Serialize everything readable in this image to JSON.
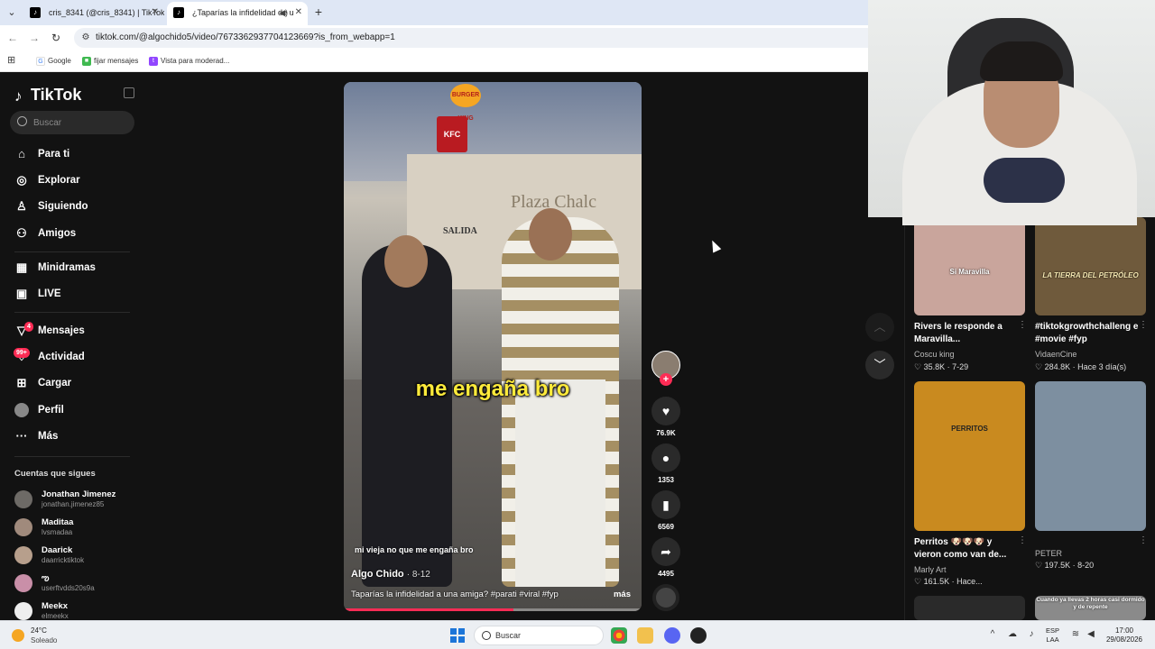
{
  "browser": {
    "tabs": [
      {
        "title": "cris_8341 (@cris_8341) | TikTok",
        "active": false
      },
      {
        "title": "¿Taparías la infidelidad de u",
        "active": true
      }
    ],
    "url": "tiktok.com/@algochido5/video/7673362937704123669?is_from_webapp=1",
    "bookmarks": [
      {
        "label": "Google"
      },
      {
        "label": "fijar mensajes"
      },
      {
        "label": "Vista para moderad..."
      }
    ]
  },
  "sidebar": {
    "logo": "TikTok",
    "search_placeholder": "Buscar",
    "nav": [
      {
        "label": "Para ti",
        "icon": "home-icon"
      },
      {
        "label": "Explorar",
        "icon": "compass-icon"
      },
      {
        "label": "Siguiendo",
        "icon": "following-icon"
      },
      {
        "label": "Amigos",
        "icon": "friends-icon"
      },
      {
        "label": "Minidramas",
        "icon": "film-icon"
      },
      {
        "label": "LIVE",
        "icon": "live-icon"
      },
      {
        "label": "Mensajes",
        "icon": "messages-icon",
        "badge": "4"
      },
      {
        "label": "Actividad",
        "icon": "activity-icon",
        "badge": "99+"
      },
      {
        "label": "Cargar",
        "icon": "upload-icon"
      },
      {
        "label": "Perfil",
        "icon": "profile-avatar"
      },
      {
        "label": "Más",
        "icon": "more-icon"
      }
    ],
    "following_title": "Cuentas que sigues",
    "following": [
      {
        "name": "Jonathan Jimenez",
        "handle": "jonathan.jimenez85"
      },
      {
        "name": "Maditaa",
        "handle": "lvsmadaa"
      },
      {
        "name": "Daarick",
        "handle": "daarricktiktok"
      },
      {
        "name": "ఌ",
        "handle": "userftvdds20s9a"
      },
      {
        "name": "Meekx",
        "handle": "elmeekx"
      }
    ]
  },
  "video": {
    "overlay_caption": "me engaña bro",
    "subtitle": "mi vieja no que me engaña bro",
    "author": "Algo Chido",
    "date": "· 8-12",
    "description": "Taparías la infidelidad a una amiga? #parati #viral #fyp",
    "more_label": "más",
    "scene_sign": "Plaza Chalc",
    "scene_salida": "SALIDA",
    "scene_kfc": "KFC",
    "scene_bk": "BURGER KING",
    "progress": 0.57
  },
  "actions": {
    "likes": "76.9K",
    "comments": "1353",
    "saves": "6569",
    "shares": "4495"
  },
  "recommendations": [
    {
      "thumb_text": "Si Maravilla",
      "title": "Rivers le responde a Maravilla...",
      "author": "Coscu king",
      "stats": "♡ 35.8K · 7-29",
      "color": "#c9a59c"
    },
    {
      "thumb_text": "LA TIERRA DEL PETRÓLEO",
      "title": "#tiktokgrowthchalleng e #movie #fyp",
      "author": "VidaenCine",
      "stats": "♡ 284.8K · Hace 3 día(s)",
      "color": "#6f5a3c"
    },
    {
      "thumb_text": "PERRITOS",
      "title": "Perritos 🐶🐶🐶 y vieron como van de...",
      "author": "Marly Art",
      "stats": "♡ 161.5K · Hace...",
      "color": "#c98a1f"
    },
    {
      "thumb_text": "",
      "title": "",
      "author": "PETER",
      "stats": "♡ 197.5K · 8-20",
      "color": "#7d8fa0"
    }
  ],
  "bottom_thumb_text": "Cuando ya llevas 2 horas casi dormido y de repente",
  "taskbar": {
    "temperature": "24°C",
    "weather": "Soleado",
    "search_label": "Buscar",
    "lang_line1": "ESP",
    "lang_line2": "LAA",
    "time": "17:00",
    "date": "29/08/2026"
  }
}
